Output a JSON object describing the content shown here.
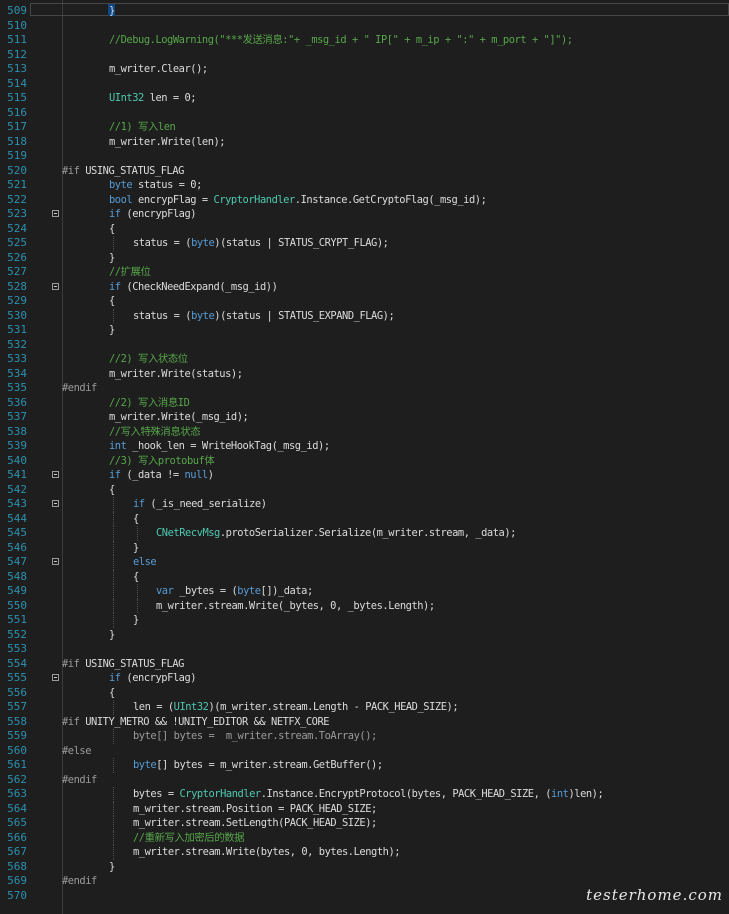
{
  "editor": {
    "current_line_number": "509",
    "lines": [
      {
        "n": "509",
        "indent": 2,
        "tokens": [
          [
            "}",
            "plain"
          ]
        ],
        "fold": false
      },
      {
        "n": "510",
        "indent": 0,
        "tokens": [],
        "fold": false
      },
      {
        "n": "511",
        "indent": 2,
        "tokens": [
          [
            "//Debug.LogWarning(\"***发送消息:\"+ _msg_id + \" IP[\" + m_ip + \":\" + m_port + \"]\");",
            "cm"
          ]
        ],
        "fold": false
      },
      {
        "n": "512",
        "indent": 0,
        "tokens": [],
        "fold": false
      },
      {
        "n": "513",
        "indent": 2,
        "tokens": [
          [
            "m_writer.Clear();",
            "plain"
          ]
        ],
        "fold": false
      },
      {
        "n": "514",
        "indent": 0,
        "tokens": [],
        "fold": false
      },
      {
        "n": "515",
        "indent": 2,
        "tokens": [
          [
            "UInt32",
            "type"
          ],
          [
            " len = 0;",
            "plain"
          ]
        ],
        "fold": false
      },
      {
        "n": "516",
        "indent": 0,
        "tokens": [],
        "fold": false
      },
      {
        "n": "517",
        "indent": 2,
        "tokens": [
          [
            "//1) 写入len",
            "cm"
          ]
        ],
        "fold": false
      },
      {
        "n": "518",
        "indent": 2,
        "tokens": [
          [
            "m_writer.Write(len);",
            "plain"
          ]
        ],
        "fold": false
      },
      {
        "n": "519",
        "indent": 0,
        "tokens": [],
        "fold": false
      },
      {
        "n": "520",
        "indent": 0,
        "tokens": [
          [
            "#if ",
            "pp"
          ],
          [
            "USING_STATUS_FLAG",
            "ppb"
          ]
        ],
        "fold": false
      },
      {
        "n": "521",
        "indent": 2,
        "tokens": [
          [
            "byte",
            "kw"
          ],
          [
            " status = 0;",
            "plain"
          ]
        ],
        "fold": false
      },
      {
        "n": "522",
        "indent": 2,
        "tokens": [
          [
            "bool",
            "kw"
          ],
          [
            " encrypFlag = ",
            "plain"
          ],
          [
            "CryptorHandler",
            "type"
          ],
          [
            ".Instance.GetCryptoFlag(_msg_id);",
            "plain"
          ]
        ],
        "fold": false
      },
      {
        "n": "523",
        "indent": 2,
        "tokens": [
          [
            "if",
            "kw"
          ],
          [
            " (encrypFlag)",
            "plain"
          ]
        ],
        "fold": true
      },
      {
        "n": "524",
        "indent": 2,
        "tokens": [
          [
            "{",
            "plain"
          ]
        ],
        "fold": false
      },
      {
        "n": "525",
        "indent": 3,
        "tokens": [
          [
            "status = (",
            "plain"
          ],
          [
            "byte",
            "kw"
          ],
          [
            ")(status | STATUS_CRYPT_FLAG);",
            "plain"
          ]
        ],
        "fold": false
      },
      {
        "n": "526",
        "indent": 2,
        "tokens": [
          [
            "}",
            "plain"
          ]
        ],
        "fold": false
      },
      {
        "n": "527",
        "indent": 2,
        "tokens": [
          [
            "//扩展位",
            "cm"
          ]
        ],
        "fold": false
      },
      {
        "n": "528",
        "indent": 2,
        "tokens": [
          [
            "if",
            "kw"
          ],
          [
            " (CheckNeedExpand(_msg_id))",
            "plain"
          ]
        ],
        "fold": true
      },
      {
        "n": "529",
        "indent": 2,
        "tokens": [
          [
            "{",
            "plain"
          ]
        ],
        "fold": false
      },
      {
        "n": "530",
        "indent": 3,
        "tokens": [
          [
            "status = (",
            "plain"
          ],
          [
            "byte",
            "kw"
          ],
          [
            ")(status | STATUS_EXPAND_FLAG);",
            "plain"
          ]
        ],
        "fold": false
      },
      {
        "n": "531",
        "indent": 2,
        "tokens": [
          [
            "}",
            "plain"
          ]
        ],
        "fold": false
      },
      {
        "n": "532",
        "indent": 0,
        "tokens": [],
        "fold": false
      },
      {
        "n": "533",
        "indent": 2,
        "tokens": [
          [
            "//2) 写入状态位",
            "cm"
          ]
        ],
        "fold": false
      },
      {
        "n": "534",
        "indent": 2,
        "tokens": [
          [
            "m_writer.Write(status);",
            "plain"
          ]
        ],
        "fold": false
      },
      {
        "n": "535",
        "indent": 0,
        "tokens": [
          [
            "#endif",
            "pp"
          ]
        ],
        "fold": false
      },
      {
        "n": "536",
        "indent": 2,
        "tokens": [
          [
            "//2) 写入消息ID",
            "cm"
          ]
        ],
        "fold": false
      },
      {
        "n": "537",
        "indent": 2,
        "tokens": [
          [
            "m_writer.Write(_msg_id);",
            "plain"
          ]
        ],
        "fold": false
      },
      {
        "n": "538",
        "indent": 2,
        "tokens": [
          [
            "//写入特殊消息状态",
            "cm"
          ]
        ],
        "fold": false
      },
      {
        "n": "539",
        "indent": 2,
        "tokens": [
          [
            "int",
            "kw"
          ],
          [
            " _hook_len = WriteHookTag(_msg_id);",
            "plain"
          ]
        ],
        "fold": false
      },
      {
        "n": "540",
        "indent": 2,
        "tokens": [
          [
            "//3) 写入protobuf体",
            "cm"
          ]
        ],
        "fold": false
      },
      {
        "n": "541",
        "indent": 2,
        "tokens": [
          [
            "if",
            "kw"
          ],
          [
            " (_data != ",
            "plain"
          ],
          [
            "null",
            "kw"
          ],
          [
            ")",
            "plain"
          ]
        ],
        "fold": true
      },
      {
        "n": "542",
        "indent": 2,
        "tokens": [
          [
            "{",
            "plain"
          ]
        ],
        "fold": false
      },
      {
        "n": "543",
        "indent": 3,
        "tokens": [
          [
            "if",
            "kw"
          ],
          [
            " (_is_need_serialize)",
            "plain"
          ]
        ],
        "fold": true
      },
      {
        "n": "544",
        "indent": 3,
        "tokens": [
          [
            "{",
            "plain"
          ]
        ],
        "fold": false
      },
      {
        "n": "545",
        "indent": 4,
        "tokens": [
          [
            "CNetRecvMsg",
            "type"
          ],
          [
            ".protoSerializer.Serialize(m_writer.stream, _data);",
            "plain"
          ]
        ],
        "fold": false
      },
      {
        "n": "546",
        "indent": 3,
        "tokens": [
          [
            "}",
            "plain"
          ]
        ],
        "fold": false
      },
      {
        "n": "547",
        "indent": 3,
        "tokens": [
          [
            "else",
            "kw"
          ]
        ],
        "fold": true
      },
      {
        "n": "548",
        "indent": 3,
        "tokens": [
          [
            "{",
            "plain"
          ]
        ],
        "fold": false
      },
      {
        "n": "549",
        "indent": 4,
        "tokens": [
          [
            "var",
            "kw"
          ],
          [
            " _bytes = (",
            "plain"
          ],
          [
            "byte",
            "kw"
          ],
          [
            "[])_data;",
            "plain"
          ]
        ],
        "fold": false
      },
      {
        "n": "550",
        "indent": 4,
        "tokens": [
          [
            "m_writer.stream.Write(_bytes, 0, _bytes.Length);",
            "plain"
          ]
        ],
        "fold": false
      },
      {
        "n": "551",
        "indent": 3,
        "tokens": [
          [
            "}",
            "plain"
          ]
        ],
        "fold": false
      },
      {
        "n": "552",
        "indent": 2,
        "tokens": [
          [
            "}",
            "plain"
          ]
        ],
        "fold": false
      },
      {
        "n": "553",
        "indent": 0,
        "tokens": [],
        "fold": false
      },
      {
        "n": "554",
        "indent": 0,
        "tokens": [
          [
            "#if ",
            "pp"
          ],
          [
            "USING_STATUS_FLAG",
            "ppb"
          ]
        ],
        "fold": false
      },
      {
        "n": "555",
        "indent": 2,
        "tokens": [
          [
            "if",
            "kw"
          ],
          [
            " (encrypFlag)",
            "plain"
          ]
        ],
        "fold": true
      },
      {
        "n": "556",
        "indent": 2,
        "tokens": [
          [
            "{",
            "plain"
          ]
        ],
        "fold": false
      },
      {
        "n": "557",
        "indent": 3,
        "tokens": [
          [
            "len = (",
            "plain"
          ],
          [
            "UInt32",
            "type"
          ],
          [
            ")(m_writer.stream.Length - PACK_HEAD_SIZE);",
            "plain"
          ]
        ],
        "fold": false
      },
      {
        "n": "558",
        "indent": 0,
        "tokens": [
          [
            "#if ",
            "pp"
          ],
          [
            "UNITY_METRO && !UNITY_EDITOR && NETFX_CORE",
            "ppb"
          ]
        ],
        "fold": false
      },
      {
        "n": "559",
        "indent": 3,
        "tokens": [
          [
            "byte[] bytes =  m_writer.stream.ToArray();",
            "dim"
          ]
        ],
        "fold": false
      },
      {
        "n": "560",
        "indent": 0,
        "tokens": [
          [
            "#else",
            "pp"
          ]
        ],
        "fold": false
      },
      {
        "n": "561",
        "indent": 3,
        "tokens": [
          [
            "byte",
            "kw"
          ],
          [
            "[] bytes = m_writer.stream.GetBuffer();",
            "plain"
          ]
        ],
        "fold": false
      },
      {
        "n": "562",
        "indent": 0,
        "tokens": [
          [
            "#endif",
            "pp"
          ]
        ],
        "fold": false
      },
      {
        "n": "563",
        "indent": 3,
        "tokens": [
          [
            "bytes = ",
            "plain"
          ],
          [
            "CryptorHandler",
            "type"
          ],
          [
            ".Instance.EncryptProtocol(bytes, PACK_HEAD_SIZE, (",
            "plain"
          ],
          [
            "int",
            "kw"
          ],
          [
            ")len);",
            "plain"
          ]
        ],
        "fold": false
      },
      {
        "n": "564",
        "indent": 3,
        "tokens": [
          [
            "m_writer.stream.Position = PACK_HEAD_SIZE;",
            "plain"
          ]
        ],
        "fold": false
      },
      {
        "n": "565",
        "indent": 3,
        "tokens": [
          [
            "m_writer.stream.SetLength(PACK_HEAD_SIZE);",
            "plain"
          ]
        ],
        "fold": false
      },
      {
        "n": "566",
        "indent": 3,
        "tokens": [
          [
            "//重新写入加密后的数据",
            "cm"
          ]
        ],
        "fold": false
      },
      {
        "n": "567",
        "indent": 3,
        "tokens": [
          [
            "m_writer.stream.Write(bytes, 0, bytes.Length);",
            "plain"
          ]
        ],
        "fold": false
      },
      {
        "n": "568",
        "indent": 2,
        "tokens": [
          [
            "}",
            "plain"
          ]
        ],
        "fold": false
      },
      {
        "n": "569",
        "indent": 0,
        "tokens": [
          [
            "#endif",
            "pp"
          ]
        ],
        "fold": false
      },
      {
        "n": "570",
        "indent": 0,
        "tokens": [],
        "fold": false
      }
    ]
  },
  "watermark": "testerhome.com",
  "colors": {
    "background": "#1e1e1e",
    "line_number": "#2b91af",
    "keyword": "#569cd6",
    "type": "#4ec9b0",
    "comment": "#57a64a",
    "preprocessor": "#9b9b9b",
    "text": "#dcdcdc"
  }
}
